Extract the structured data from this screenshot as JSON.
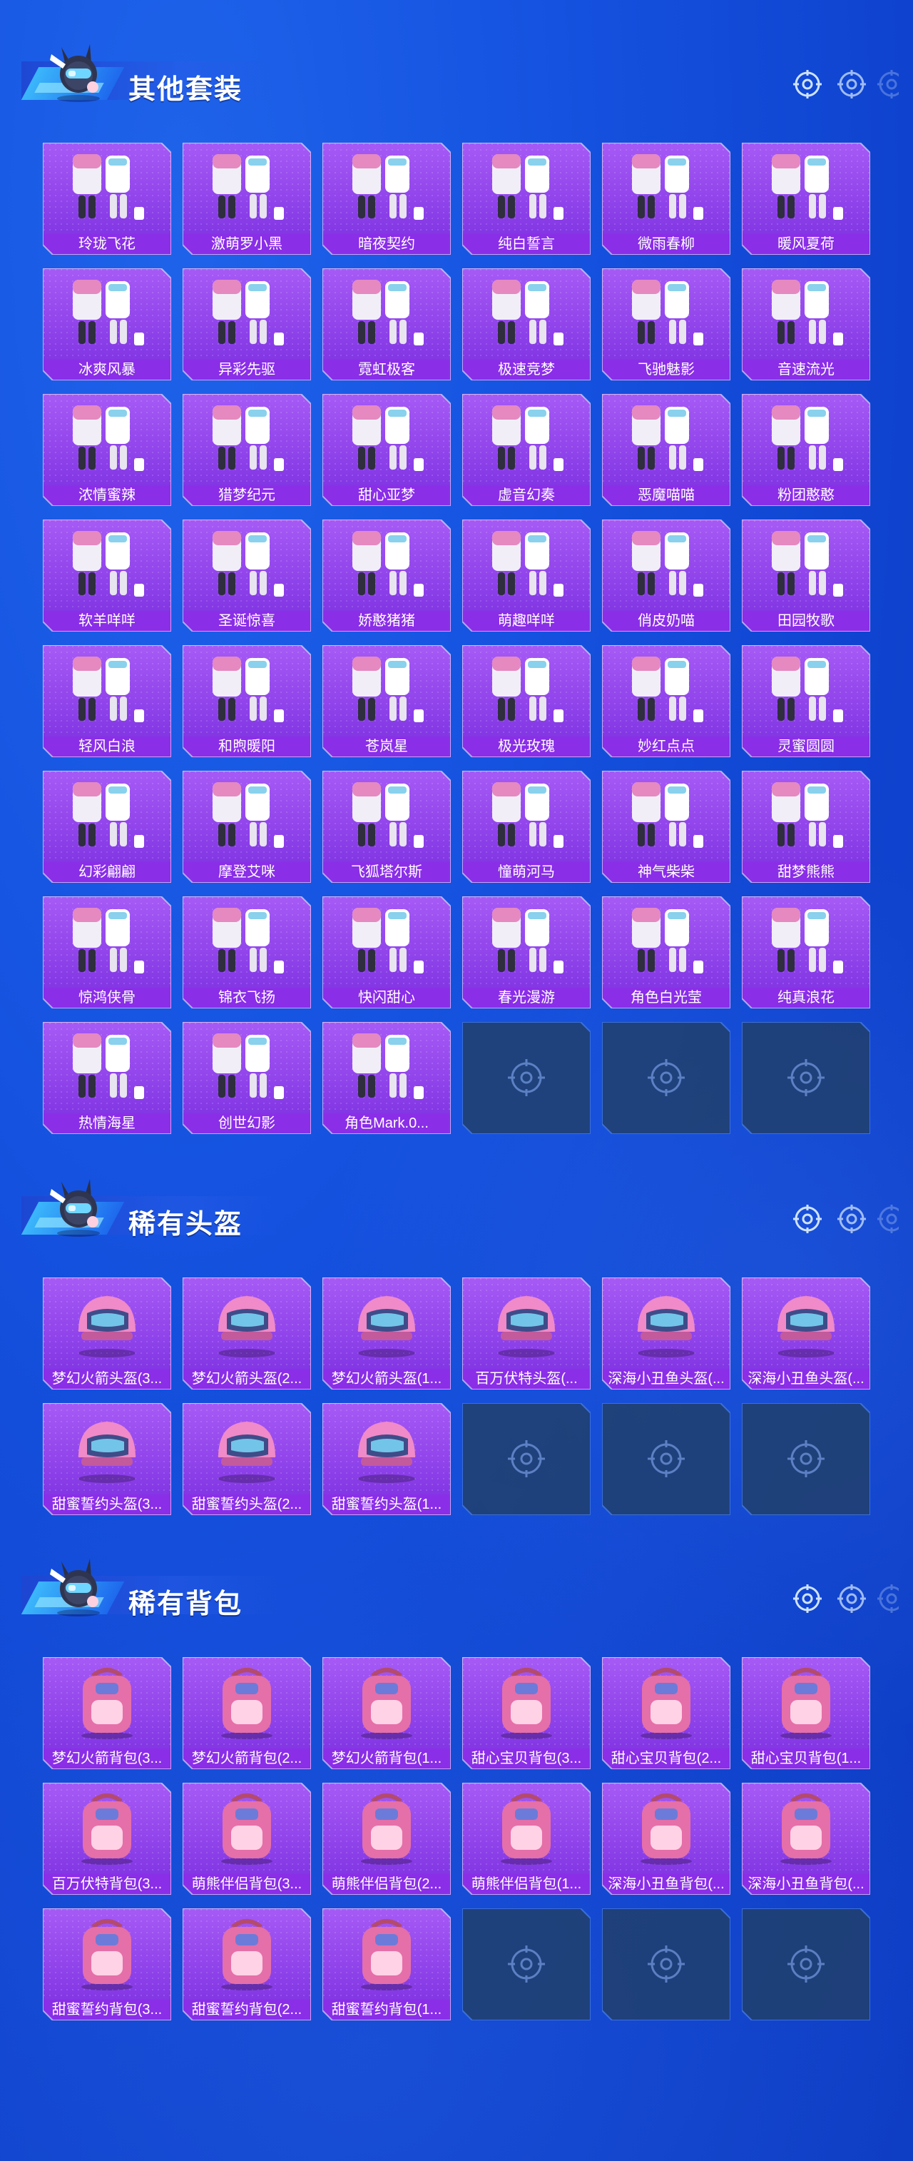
{
  "colors": {
    "page_bg": "#1553e0",
    "card_purple_top": "#a65af5",
    "card_purple_bottom": "#7b2fe0",
    "label_bar": "#8a2ee8",
    "empty_slot": "#21406b",
    "empty_border": "#3c6fd6"
  },
  "sections": [
    {
      "title": "其他套装",
      "icon": "mascot-icon",
      "items": [
        "玲珑飞花",
        "激萌罗小黑",
        "暗夜契约",
        "纯白誓言",
        "微雨春柳",
        "暖风夏荷",
        "冰爽风暴",
        "异彩先驱",
        "霓虹极客",
        "极速竞梦",
        "飞驰魅影",
        "音速流光",
        "浓情蜜辣",
        "猎梦纪元",
        "甜心亚梦",
        "虚音幻奏",
        "恶魔喵喵",
        "粉团憨憨",
        "软羊咩咩",
        "圣诞惊喜",
        "娇憨猪猪",
        "萌趣咩咩",
        "俏皮奶喵",
        "田园牧歌",
        "轻风白浪",
        "和煦暖阳",
        "苍岚星",
        "极光玫瑰",
        "妙红点点",
        "灵蜜圆圆",
        "幻彩翩翩",
        "摩登艾咪",
        "飞狐塔尔斯",
        "憧萌河马",
        "神气柴柴",
        "甜梦熊熊",
        "惊鸿侠骨",
        "锦衣飞扬",
        "快闪甜心",
        "春光漫游",
        "角色白光莹",
        "纯真浪花",
        "热情海星",
        "创世幻影",
        "角色Mark.0..."
      ],
      "empty_slots": 3
    },
    {
      "title": "稀有头盔",
      "icon": "mascot-icon",
      "items": [
        "梦幻火箭头盔(3...",
        "梦幻火箭头盔(2...",
        "梦幻火箭头盔(1...",
        "百万伏特头盔(...",
        "深海小丑鱼头盔(...",
        "深海小丑鱼头盔(...",
        "甜蜜誓约头盔(3...",
        "甜蜜誓约头盔(2...",
        "甜蜜誓约头盔(1..."
      ],
      "empty_slots": 3
    },
    {
      "title": "稀有背包",
      "icon": "mascot-icon",
      "items": [
        "梦幻火箭背包(3...",
        "梦幻火箭背包(2...",
        "梦幻火箭背包(1...",
        "甜心宝贝背包(3...",
        "甜心宝贝背包(2...",
        "甜心宝贝背包(1...",
        "百万伏特背包(3...",
        "萌熊伴侣背包(3...",
        "萌熊伴侣背包(2...",
        "萌熊伴侣背包(1...",
        "深海小丑鱼背包(...",
        "深海小丑鱼背包(...",
        "甜蜜誓约背包(3...",
        "甜蜜誓约背包(2...",
        "甜蜜誓约背包(1..."
      ],
      "empty_slots": 3
    }
  ]
}
